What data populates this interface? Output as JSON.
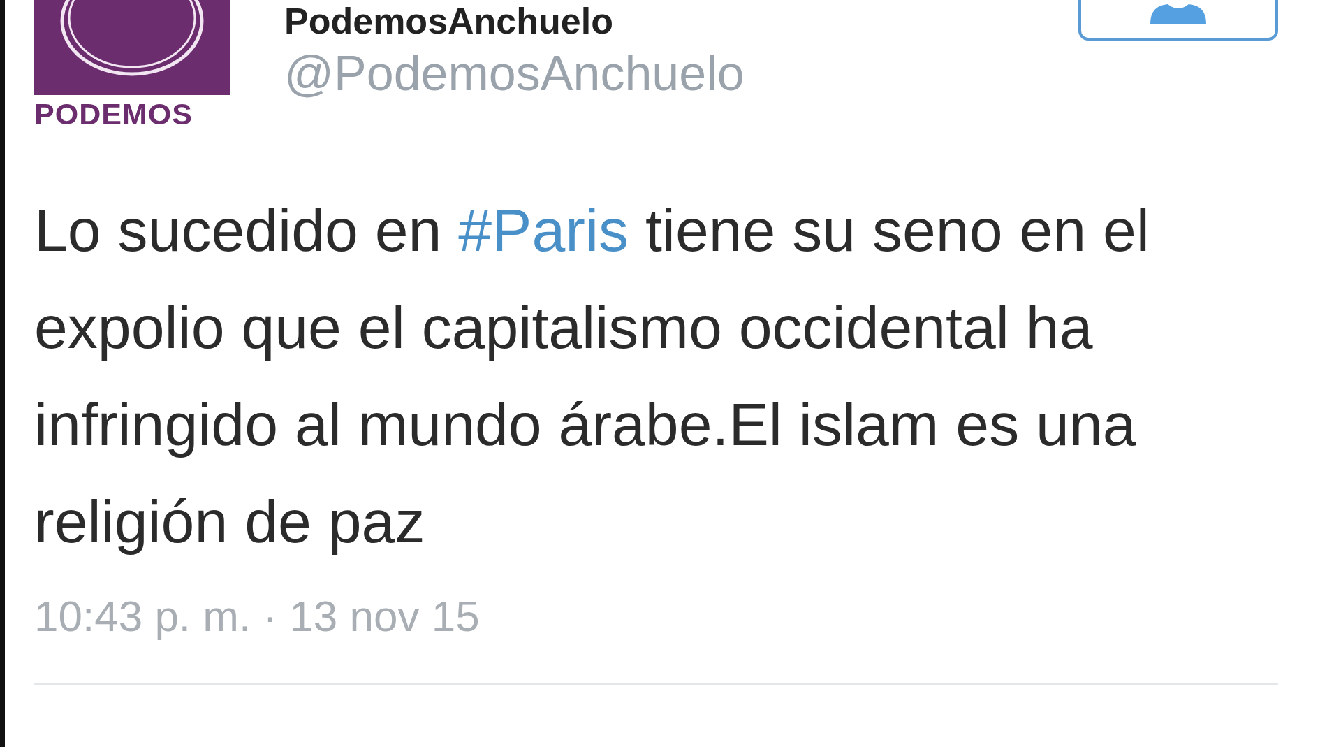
{
  "account": {
    "name": "PodemosAnchuelo",
    "handle": "@PodemosAnchuelo",
    "logo_text": "PODEMOS"
  },
  "tweet": {
    "segments": [
      {
        "kind": "text",
        "text": "Lo sucedido en "
      },
      {
        "kind": "hashtag",
        "text": "#Paris"
      },
      {
        "kind": "text",
        "text": " tiene su seno en el expolio que el capitalismo occidental ha infringido al mundo árabe.El islam es una religión de paz"
      }
    ],
    "timestamp": "10:43 p. m. · 13 nov 15"
  }
}
